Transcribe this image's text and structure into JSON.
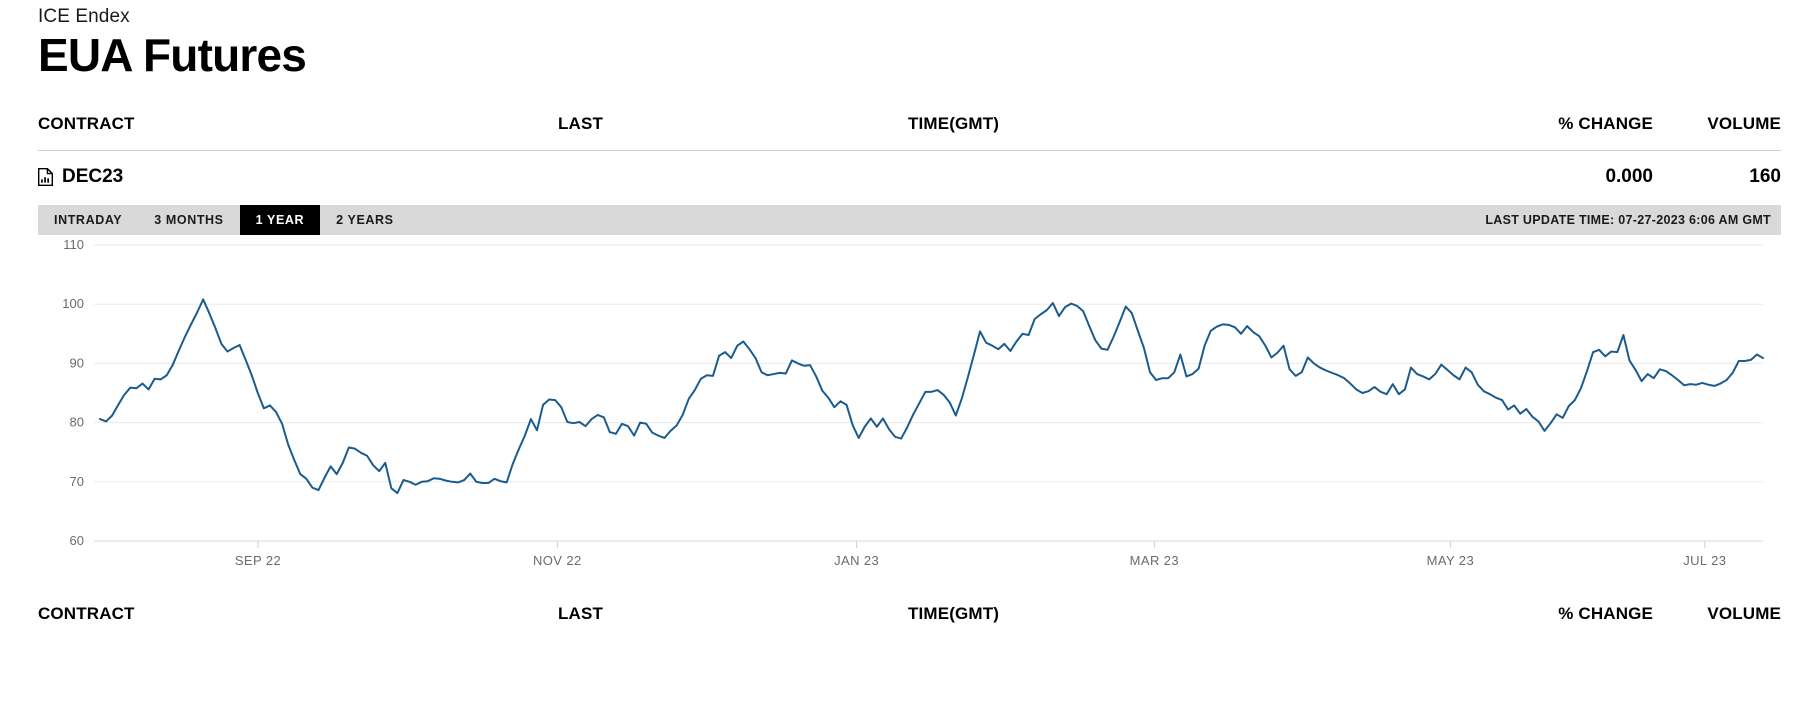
{
  "header": {
    "exchange": "ICE Endex",
    "title": "EUA Futures"
  },
  "table": {
    "columns": {
      "contract": "CONTRACT",
      "last": "LAST",
      "time": "TIME(GMT)",
      "change": "% CHANGE",
      "volume": "VOLUME"
    },
    "rows": [
      {
        "icon": "document-chart-icon",
        "contract": "DEC23",
        "last": "",
        "time": "",
        "change": "0.000",
        "volume": "160"
      }
    ],
    "footer_columns": {
      "contract": "CONTRACT",
      "last": "LAST",
      "time": "TIME(GMT)",
      "change": "% CHANGE",
      "volume": "VOLUME"
    }
  },
  "toolbar": {
    "tabs": [
      {
        "label": "INTRADAY",
        "active": false
      },
      {
        "label": "3 MONTHS",
        "active": false
      },
      {
        "label": "1 YEAR",
        "active": true
      },
      {
        "label": "2 YEARS",
        "active": false
      }
    ],
    "last_update": "LAST UPDATE TIME: 07-27-2023 6:06 AM GMT",
    "background_color": "#d9d9d9",
    "active_tab_color": "#000000"
  },
  "chart_data": {
    "type": "line",
    "title": "",
    "xlabel": "",
    "ylabel": "",
    "ylim": [
      60,
      110
    ],
    "yticks": [
      60,
      70,
      80,
      90,
      100,
      110
    ],
    "grid": true,
    "legend": null,
    "line_color": "#1b5c8e",
    "line_width": 2,
    "xticks": [
      "SEP 22",
      "NOV 22",
      "JAN 23",
      "MAR 23",
      "MAY 23",
      "JUL 23"
    ],
    "xtick_positions": [
      0.095,
      0.275,
      0.455,
      0.634,
      0.812,
      0.965
    ],
    "series": [
      {
        "name": "DEC23",
        "values": [
          80.6,
          80.2,
          81.2,
          83.0,
          84.7,
          85.9,
          85.8,
          86.6,
          85.6,
          87.4,
          87.3,
          88.0,
          89.8,
          92.2,
          94.5,
          96.6,
          98.6,
          100.8,
          98.5,
          96.0,
          93.3,
          92.0,
          92.6,
          93.1,
          90.6,
          88.0,
          85.0,
          82.4,
          82.9,
          81.8,
          79.8,
          76.3,
          73.7,
          71.3,
          70.5,
          69.0,
          68.6,
          70.7,
          72.6,
          71.3,
          73.2,
          75.8,
          75.6,
          74.9,
          74.4,
          72.8,
          71.8,
          73.2,
          68.9,
          68.1,
          70.3,
          70.0,
          69.5,
          70.0,
          70.1,
          70.6,
          70.5,
          70.2,
          70.0,
          69.9,
          70.3,
          71.4,
          70.0,
          69.8,
          69.8,
          70.5,
          70.1,
          69.9,
          73.0,
          75.5,
          77.8,
          80.6,
          78.7,
          83.0,
          83.9,
          83.8,
          82.6,
          80.1,
          79.9,
          80.1,
          79.4,
          80.6,
          81.3,
          80.9,
          78.4,
          78.1,
          79.8,
          79.4,
          77.8,
          80.0,
          79.8,
          78.3,
          77.8,
          77.4,
          78.6,
          79.5,
          81.3,
          84.0,
          85.5,
          87.4,
          88.0,
          87.9,
          91.3,
          91.9,
          90.9,
          93.0,
          93.7,
          92.4,
          90.9,
          88.5,
          88.0,
          88.2,
          88.4,
          88.3,
          90.5,
          90.0,
          89.6,
          89.7,
          87.8,
          85.4,
          84.2,
          82.6,
          83.6,
          83.0,
          79.6,
          77.4,
          79.3,
          80.7,
          79.3,
          80.7,
          78.9,
          77.6,
          77.3,
          79.2,
          81.4,
          83.3,
          85.2,
          85.2,
          85.5,
          84.7,
          83.4,
          81.2,
          84.1,
          87.7,
          91.5,
          95.4,
          93.5,
          93.0,
          92.4,
          93.3,
          92.1,
          93.7,
          95.0,
          94.8,
          97.5,
          98.3,
          99.0,
          100.2,
          98.0,
          99.5,
          100.1,
          99.7,
          98.8,
          96.3,
          93.9,
          92.5,
          92.3,
          94.5,
          97.0,
          99.6,
          98.5,
          95.5,
          92.6,
          88.5,
          87.2,
          87.5,
          87.5,
          88.5,
          91.5,
          87.8,
          88.2,
          89.1,
          93.0,
          95.5,
          96.2,
          96.6,
          96.5,
          96.1,
          95.0,
          96.3,
          95.3,
          94.6,
          93.0,
          91.0,
          91.8,
          93.0,
          89.0,
          87.9,
          88.5,
          91.0,
          90.0,
          89.3,
          88.8,
          88.4,
          88.0,
          87.5,
          86.6,
          85.6,
          85.0,
          85.3,
          86.0,
          85.2,
          84.8,
          86.5,
          84.8,
          85.6,
          89.3,
          88.2,
          87.8,
          87.3,
          88.2,
          89.8,
          88.9,
          88.0,
          87.3,
          89.3,
          88.5,
          86.4,
          85.3,
          84.8,
          84.2,
          83.8,
          82.2,
          82.9,
          81.5,
          82.3,
          81.0,
          80.2,
          78.6,
          79.9,
          81.4,
          80.8,
          82.8,
          83.8,
          85.8,
          88.7,
          91.9,
          92.3,
          91.2,
          92.0,
          91.9,
          94.8,
          90.5,
          88.9,
          87.0,
          88.2,
          87.5,
          89.0,
          88.7,
          88.0,
          87.2,
          86.3,
          86.5,
          86.4,
          86.7,
          86.4,
          86.2,
          86.6,
          87.2,
          88.4,
          90.4,
          90.4,
          90.6,
          91.5,
          90.9
        ]
      }
    ]
  }
}
